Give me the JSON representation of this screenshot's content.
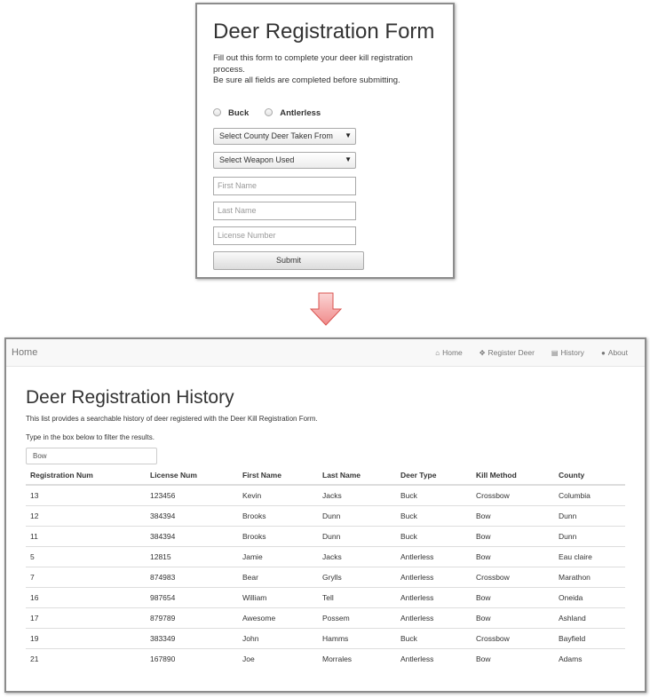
{
  "form": {
    "title": "Deer Registration Form",
    "description_line1": "Fill out this form to complete your deer kill registration process.",
    "description_line2": "Be sure all fields are completed before submitting.",
    "radio_buck": "Buck",
    "radio_antlerless": "Antlerless",
    "county_select": "Select County Deer Taken From",
    "weapon_select": "Select Weapon Used",
    "first_name_placeholder": "First Name",
    "last_name_placeholder": "Last Name",
    "license_placeholder": "License Number",
    "submit_label": "Submit"
  },
  "navbar": {
    "brand": "Home",
    "links": [
      {
        "label": "Home",
        "icon": "home-icon"
      },
      {
        "label": "Register Deer",
        "icon": "move-icon"
      },
      {
        "label": "History",
        "icon": "list-icon"
      },
      {
        "label": "About",
        "icon": "user-icon"
      }
    ]
  },
  "history": {
    "title": "Deer Registration History",
    "description": "This list provides a searchable history of deer registered with the Deer Kill Registration Form.",
    "filter_hint": "Type in the box below to filter the results.",
    "filter_value": "Bow",
    "columns": [
      "Registration Num",
      "License Num",
      "First Name",
      "Last Name",
      "Deer Type",
      "Kill Method",
      "County"
    ],
    "rows": [
      [
        "13",
        "123456",
        "Kevin",
        "Jacks",
        "Buck",
        "Crossbow",
        "Columbia"
      ],
      [
        "12",
        "384394",
        "Brooks",
        "Dunn",
        "Buck",
        "Bow",
        "Dunn"
      ],
      [
        "11",
        "384394",
        "Brooks",
        "Dunn",
        "Buck",
        "Bow",
        "Dunn"
      ],
      [
        "5",
        "12815",
        "Jamie",
        "Jacks",
        "Antlerless",
        "Bow",
        "Eau claire"
      ],
      [
        "7",
        "874983",
        "Bear",
        "Grylls",
        "Antlerless",
        "Crossbow",
        "Marathon"
      ],
      [
        "16",
        "987654",
        "William",
        "Tell",
        "Antlerless",
        "Bow",
        "Oneida"
      ],
      [
        "17",
        "879789",
        "Awesome",
        "Possem",
        "Antlerless",
        "Bow",
        "Ashland"
      ],
      [
        "19",
        "383349",
        "John",
        "Hamms",
        "Buck",
        "Crossbow",
        "Bayfield"
      ],
      [
        "21",
        "167890",
        "Joe",
        "Morrales",
        "Antlerless",
        "Bow",
        "Adams"
      ]
    ]
  },
  "colors": {
    "arrow_fill": "#f4a7a7",
    "arrow_stroke": "#d9534f"
  }
}
